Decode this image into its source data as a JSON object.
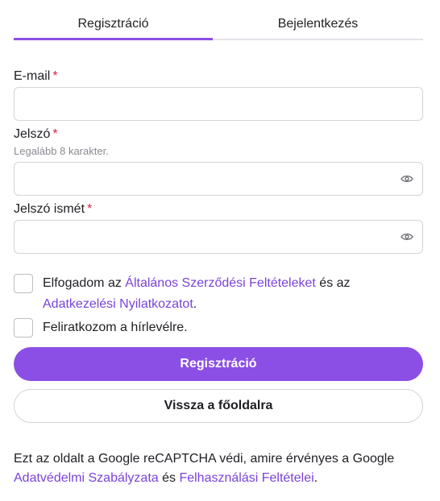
{
  "tabs": {
    "register": "Regisztráció",
    "login": "Bejelentkezés"
  },
  "form": {
    "email_label": "E-mail",
    "password_label": "Jelszó",
    "password_hint": "Legalább 8 karakter.",
    "password_confirm_label": "Jelszó ismét",
    "required_mark": "*"
  },
  "consent": {
    "terms_prefix": "Elfogadom az ",
    "terms_link": "Általános Szerződési Feltételeket",
    "terms_middle": " és az ",
    "privacy_link": "Adatkezelési Nyilatkozatot",
    "terms_suffix": ".",
    "newsletter": "Feliratkozom a hírlevélre."
  },
  "buttons": {
    "register": "Regisztráció",
    "back_home": "Vissza a főoldalra"
  },
  "footer": {
    "prefix": "Ezt az oldalt a Google reCAPTCHA védi, amire érvényes a Google ",
    "privacy_link": "Adatvédelmi Szabályzata",
    "middle": " és ",
    "terms_link": "Felhasználási Feltételei",
    "suffix": "."
  },
  "icons": {
    "show_password": "eye-icon"
  },
  "colors": {
    "accent": "#8b4fe6",
    "link": "#7a43d9",
    "required": "#e0214a"
  }
}
